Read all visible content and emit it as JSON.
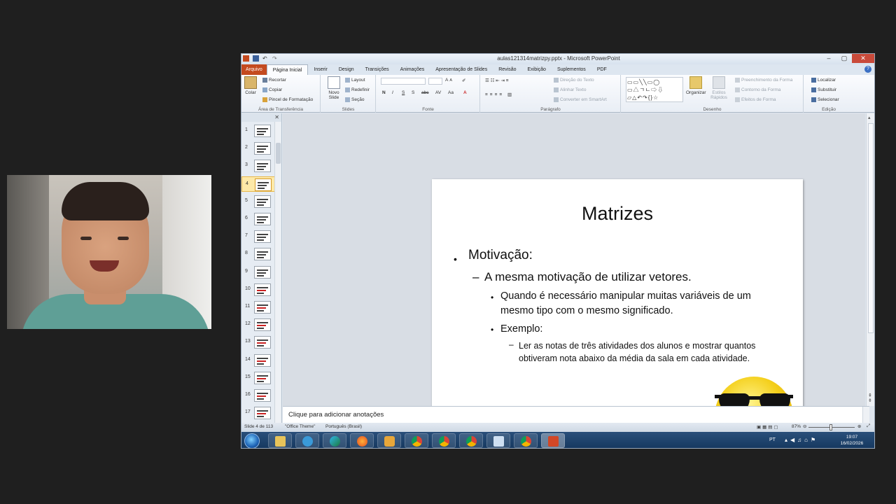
{
  "window": {
    "title": "aulas121314matrizpy.pptx - Microsoft PowerPoint"
  },
  "ribbon_tabs": [
    "Arquivo",
    "Página Inicial",
    "Inserir",
    "Design",
    "Transições",
    "Animações",
    "Apresentação de Slides",
    "Revisão",
    "Exibição",
    "Suplementos",
    "PDF"
  ],
  "ribbon": {
    "clipboard": {
      "paste": "Colar",
      "cut": "Recortar",
      "copy": "Copiar",
      "format_painter": "Pincel de Formatação",
      "group": "Área de Transferência"
    },
    "slides": {
      "new_slide": "Novo Slide",
      "layout": "Layout",
      "reset": "Redefinir",
      "section": "Seção",
      "group": "Slides"
    },
    "font": {
      "group": "Fonte",
      "bold": "N",
      "italic": "I",
      "underline": "S",
      "shadow": "S",
      "strike": "abc"
    },
    "paragraph": {
      "group": "Parágrafo",
      "text_direction": "Direção do Texto",
      "align_text": "Alinhar Texto",
      "smartart": "Converter em SmartArt"
    },
    "drawing": {
      "group": "Desenho",
      "arrange": "Organizar",
      "quick_styles": "Estilos Rápidos",
      "fill": "Preenchimento da Forma",
      "outline": "Contorno da Forma",
      "effects": "Efeitos de Forma"
    },
    "editing": {
      "group": "Edição",
      "find": "Localizar",
      "replace": "Substituir",
      "select": "Selecionar"
    }
  },
  "thumbnails": {
    "numbers": [
      "1",
      "2",
      "3",
      "4",
      "5",
      "6",
      "7",
      "8",
      "9",
      "10",
      "11",
      "12",
      "13",
      "14",
      "15",
      "16",
      "17"
    ],
    "selected": "4"
  },
  "slide": {
    "title": "Matrizes",
    "bullet1": "Motivação:",
    "bullet2": "A mesma motivação de utilizar vetores.",
    "bullet3a_line1": "Quando é necessário manipular muitas variáveis de um",
    "bullet3a_line2": "mesmo tipo com o mesmo significado.",
    "bullet3b": "Exemplo:",
    "bullet4_line1": "Ler as notas de três atividades dos alunos e mostrar quantos",
    "bullet4_line2": "obtiveram nota abaixo da média da sala em cada atividade."
  },
  "notes": {
    "placeholder": "Clique para adicionar anotações"
  },
  "statusbar": {
    "slide_info": "Slide 4 de 113",
    "theme": "\"Office Theme\"",
    "language": "Português (Brasil)",
    "zoom": "87%"
  },
  "taskbar": {
    "lang": "PT",
    "time": "19:07",
    "date": "16/02/2026"
  },
  "colors": {
    "file_tab": "#c44a1f",
    "selected_thumb": "#fde9a8",
    "taskbar": "#14375e"
  }
}
